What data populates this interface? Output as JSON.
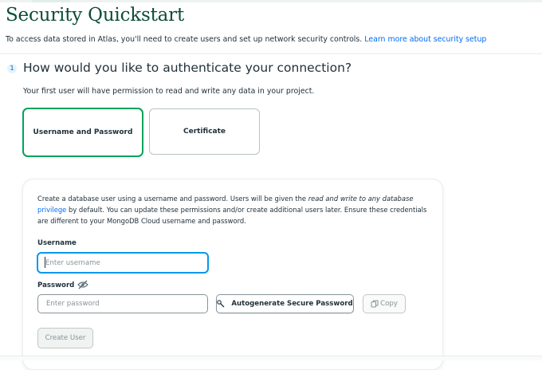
{
  "header": {
    "title": "Security Quickstart",
    "intro_text": "To access data stored in Atlas, you'll need to create users and set up network security controls.",
    "intro_link": "Learn more about security setup"
  },
  "step": {
    "number": "1",
    "question": "How would you like to authenticate your connection?",
    "subtext": "Your first user will have permission to read and write any data in your project."
  },
  "auth_options": {
    "username_password": "Username and Password",
    "certificate": "Certificate",
    "selected": "Username and Password"
  },
  "form": {
    "description_1": "Create a database user using a username and password. Users will be given the",
    "description_em": "read and write to any database",
    "description_link": "privilege",
    "description_2": "by default. You can update these permissions and/or create additional users later. Ensure these credentials are different to your MongoDB Cloud username and password.",
    "username_label": "Username",
    "username_value": "",
    "username_placeholder": "Enter username",
    "password_label": "Password",
    "password_value": "",
    "password_placeholder": "Enter password",
    "autogenerate_label": "Autogenerate Secure Password",
    "copy_label": "Copy",
    "create_user_label": "Create User"
  },
  "icons": {
    "eye_off": "eye-slash-icon",
    "autogenerate": "magic-wand-icon",
    "copy": "copy-icon"
  },
  "colors": {
    "title_green": "#0b4d3a",
    "selected_border": "#00a35c",
    "focus_border": "#0498ec",
    "link_blue": "#016bf8"
  }
}
